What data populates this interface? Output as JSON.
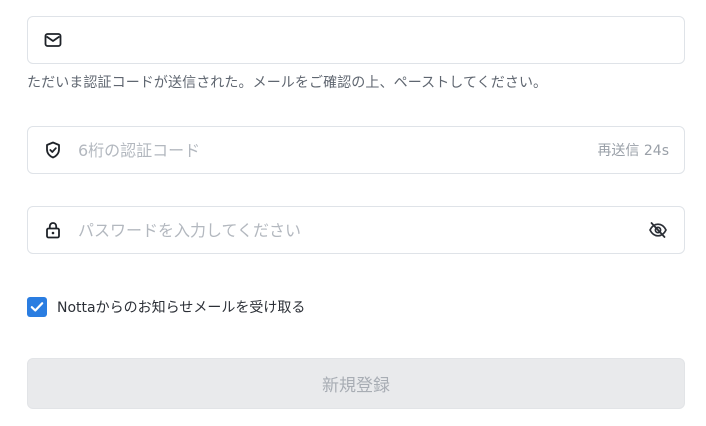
{
  "email": {
    "value": "",
    "placeholder": "",
    "icon": "mail-icon"
  },
  "hint_text": "ただいま認証コードが送信された。メールをご確認の上、ペーストしてください。",
  "verification": {
    "placeholder": "6桁の認証コード",
    "value": "",
    "icon": "shield-check-icon",
    "resend_label": "再送信 24s"
  },
  "password": {
    "placeholder": "パスワードを入力してください",
    "value": "",
    "icon": "lock-icon",
    "toggle_icon": "eye-off-icon"
  },
  "newsletter": {
    "checked": true,
    "label": "Nottaからのお知らせメールを受け取る"
  },
  "submit": {
    "label": "新規登録",
    "disabled": true
  },
  "colors": {
    "accent": "#2a7de1",
    "border": "#dfe3e8",
    "placeholder": "#b3b8bf",
    "disabled_bg": "#e9eaec",
    "disabled_text": "#a8adb4"
  }
}
